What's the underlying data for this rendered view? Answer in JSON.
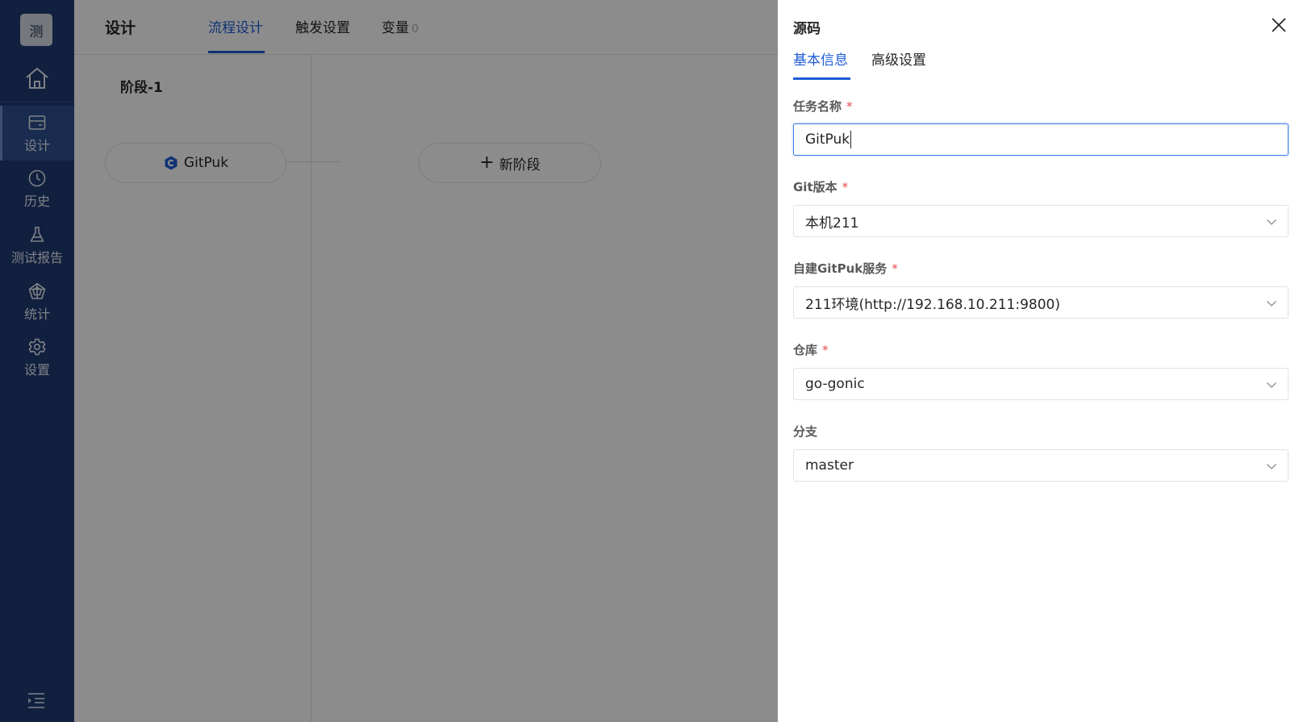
{
  "sidebar": {
    "logo_text": "测",
    "items": [
      {
        "label": "设计",
        "icon": "design-icon",
        "active": true
      },
      {
        "label": "历史",
        "icon": "clock-icon",
        "active": false
      },
      {
        "label": "测试报告",
        "icon": "flask-icon",
        "active": false
      },
      {
        "label": "统计",
        "icon": "chart-icon",
        "active": false
      },
      {
        "label": "设置",
        "icon": "gear-icon",
        "active": false
      }
    ]
  },
  "header": {
    "title": "设计",
    "tabs": [
      {
        "label": "流程设计",
        "active": true
      },
      {
        "label": "触发设置",
        "active": false
      },
      {
        "label": "变量",
        "count": "0",
        "active": false
      }
    ]
  },
  "pipeline": {
    "stage_title": "阶段-1",
    "job_label": "GitPuk",
    "add_stage_label": "新阶段"
  },
  "drawer": {
    "title": "源码",
    "tabs": [
      {
        "label": "基本信息",
        "active": true
      },
      {
        "label": "高级设置",
        "active": false
      }
    ],
    "fields": {
      "task_name": {
        "label": "任务名称",
        "required": "*",
        "value": "GitPuk"
      },
      "git_version": {
        "label": "Git版本",
        "required": "*",
        "value": "本机211"
      },
      "gitpuk_service": {
        "label": "自建GitPuk服务",
        "required": "*",
        "value": "211环境(http://192.168.10.211:9800)"
      },
      "repository": {
        "label": "仓库",
        "required": "*",
        "value": "go-gonic"
      },
      "branch": {
        "label": "分支",
        "value": "master"
      }
    }
  },
  "colors": {
    "sidebar_bg": "#1f3b74",
    "accent": "#1d5bd6",
    "required": "#e5484d"
  }
}
